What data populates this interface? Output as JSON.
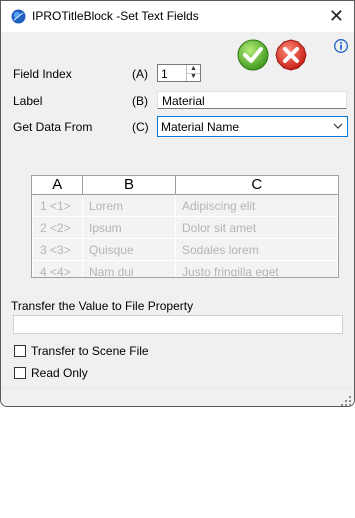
{
  "window": {
    "title": "IPROTitleBlock -Set Text Fields",
    "close_glyph": "✕",
    "icons": {
      "app": "app-globe-icon",
      "ok": "checkmark-icon",
      "cancel": "x-mark-icon",
      "info": "info-icon"
    },
    "colors": {
      "ok": "#6dbf2e",
      "cancel": "#e8352f",
      "info": "#1c64c8",
      "focus": "#0078d7"
    }
  },
  "form": {
    "field_index": {
      "label": "Field Index",
      "letter": "(A)",
      "value": "1",
      "stepper_up": "▲",
      "stepper_down": "▼"
    },
    "label_field": {
      "label": "Label",
      "letter": "(B)",
      "value": "Material"
    },
    "data_from": {
      "label": "Get Data From",
      "letter": "(C)",
      "value": "Material Name"
    }
  },
  "grid": {
    "headers": [
      "A",
      "B",
      "C"
    ],
    "rows": [
      [
        "1 <1>",
        "Lorem",
        "Adipiscing elit"
      ],
      [
        "2 <2>",
        "Ipsum",
        "Dolor sit amet"
      ],
      [
        "3 <3>",
        "Quisque",
        "Sodales lorem"
      ],
      [
        "4 <4>",
        "Nam dui",
        "Justo fringilla eget"
      ]
    ]
  },
  "transfer": {
    "label": "Transfer the Value to File Property",
    "value": ""
  },
  "options": {
    "scene_file": {
      "label": "Transfer to Scene File",
      "checked": false
    },
    "read_only": {
      "label": "Read Only",
      "checked": false
    }
  }
}
